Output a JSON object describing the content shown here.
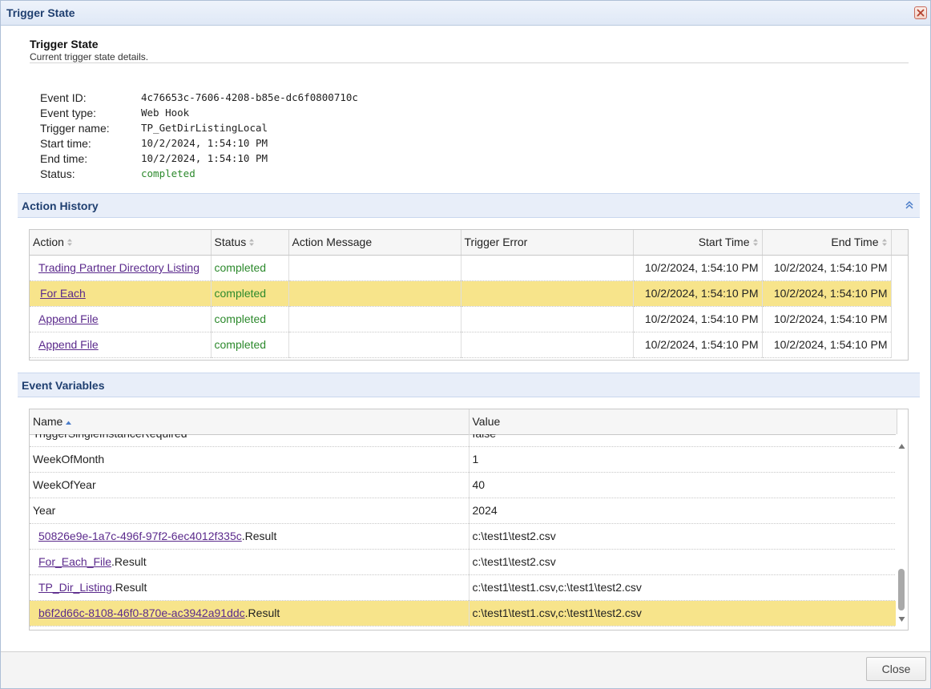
{
  "window": {
    "title": "Trigger State",
    "close_label": "Close"
  },
  "header": {
    "title": "Trigger State",
    "subtitle": "Current trigger state details."
  },
  "info": [
    {
      "label": "Event ID:",
      "value": "4c76653c-7606-4208-b85e-dc6f0800710c"
    },
    {
      "label": "Event type:",
      "value": "Web Hook"
    },
    {
      "label": "Trigger name:",
      "value": "TP_GetDirListingLocal"
    },
    {
      "label": "Start time:",
      "value": "10/2/2024, 1:54:10 PM"
    },
    {
      "label": "End time:",
      "value": "10/2/2024, 1:54:10 PM"
    },
    {
      "label": "Status:",
      "value": "completed"
    }
  ],
  "action_history": {
    "title": "Action History",
    "columns": [
      "Action",
      "Status",
      "Action Message",
      "Trigger Error",
      "Start Time",
      "End Time"
    ],
    "rows": [
      {
        "action": "Trading Partner Directory Listing",
        "status": "completed",
        "message": "",
        "error": "",
        "start": "10/2/2024, 1:54:10 PM",
        "end": "10/2/2024, 1:54:10 PM"
      },
      {
        "action": "For Each",
        "status": "completed",
        "message": "",
        "error": "",
        "start": "10/2/2024, 1:54:10 PM",
        "end": "10/2/2024, 1:54:10 PM"
      },
      {
        "action": "Append File",
        "status": "completed",
        "message": "",
        "error": "",
        "start": "10/2/2024, 1:54:10 PM",
        "end": "10/2/2024, 1:54:10 PM"
      },
      {
        "action": "Append File",
        "status": "completed",
        "message": "",
        "error": "",
        "start": "10/2/2024, 1:54:10 PM",
        "end": "10/2/2024, 1:54:10 PM"
      }
    ]
  },
  "event_variables": {
    "title": "Event Variables",
    "columns": [
      "Name",
      "Value"
    ],
    "rows": [
      {
        "name": "TriggerSingleInstanceRequired",
        "link": "",
        "suffix": "",
        "value": "false"
      },
      {
        "name": "WeekOfMonth",
        "link": "",
        "suffix": "",
        "value": "1"
      },
      {
        "name": "WeekOfYear",
        "link": "",
        "suffix": "",
        "value": "40"
      },
      {
        "name": "Year",
        "link": "",
        "suffix": "",
        "value": "2024"
      },
      {
        "name": "",
        "link": "50826e9e-1a7c-496f-97f2-6ec4012f335c",
        "suffix": ".Result",
        "value": "c:\\test1\\test2.csv"
      },
      {
        "name": "",
        "link": "For_Each_File",
        "suffix": ".Result",
        "value": "c:\\test1\\test2.csv"
      },
      {
        "name": "",
        "link": "TP_Dir_Listing",
        "suffix": ".Result",
        "value": "c:\\test1\\test1.csv,c:\\test1\\test2.csv"
      },
      {
        "name": "",
        "link": "b6f2d66c-8108-46f0-870e-ac3942a91ddc",
        "suffix": ".Result",
        "value": "c:\\test1\\test1.csv,c:\\test1\\test2.csv"
      }
    ]
  },
  "colors": {
    "highlight": "#f7e48b",
    "status_ok": "#2d8a2d",
    "link": "#5b2a8c",
    "panel_header": "#e8eef9"
  }
}
